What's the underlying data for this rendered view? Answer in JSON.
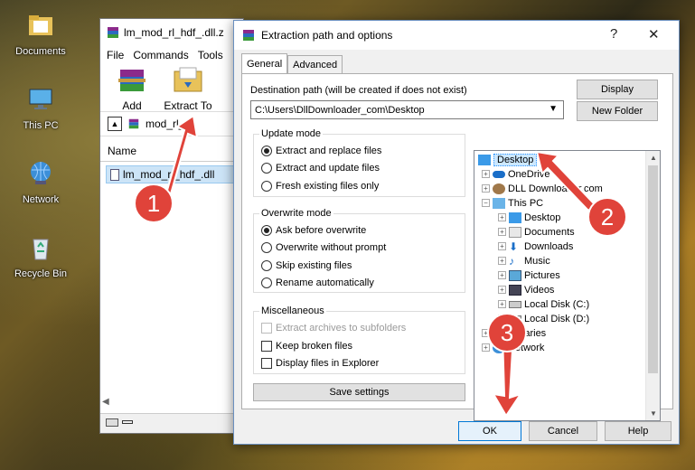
{
  "desktop": {
    "icons": [
      {
        "label": "Documents",
        "icon": "folder-icon"
      },
      {
        "label": "This PC",
        "icon": "computer-icon"
      },
      {
        "label": "Network",
        "icon": "network-icon"
      },
      {
        "label": "Recycle Bin",
        "icon": "recycle-bin-icon"
      }
    ]
  },
  "winrar": {
    "title": "lm_mod_rl_hdf_.dll.z",
    "menu": [
      "File",
      "Commands",
      "Tools"
    ],
    "tools": [
      {
        "label": "Add",
        "icon": "add-archive-icon"
      },
      {
        "label": "Extract To",
        "icon": "extract-to-icon"
      }
    ],
    "path": "mod_rl_",
    "column_name": "Name",
    "file": "lm_mod_rl_hdf_.dll"
  },
  "dialog": {
    "title": "Extraction path and options",
    "help": "?",
    "close": "✕",
    "tabs": [
      "General",
      "Advanced"
    ],
    "dest_label": "Destination path (will be created if does not exist)",
    "dest_value": "C:\\Users\\DllDownloader_com\\Desktop",
    "display_button": "Display",
    "new_folder_button": "New Folder",
    "update_mode": {
      "title": "Update mode",
      "options": [
        "Extract and replace files",
        "Extract and update files",
        "Fresh existing files only"
      ],
      "selected": 0
    },
    "overwrite_mode": {
      "title": "Overwrite mode",
      "options": [
        "Ask before overwrite",
        "Overwrite without prompt",
        "Skip existing files",
        "Rename automatically"
      ],
      "selected": 0
    },
    "misc": {
      "title": "Miscellaneous",
      "options": [
        "Extract archives to subfolders",
        "Keep broken files",
        "Display files in Explorer"
      ]
    },
    "save_settings": "Save settings",
    "tree": [
      {
        "label": "Desktop",
        "selected": true
      },
      {
        "label": "OneDrive"
      },
      {
        "label": "DLL Downloader.com"
      },
      {
        "label": "This PC"
      },
      {
        "label": "Desktop"
      },
      {
        "label": "Documents"
      },
      {
        "label": "Downloads"
      },
      {
        "label": "Music"
      },
      {
        "label": "Pictures"
      },
      {
        "label": "Videos"
      },
      {
        "label": "Local Disk (C:)"
      },
      {
        "label": "Local Disk (D:)"
      },
      {
        "label": "Libraries"
      },
      {
        "label": "Network"
      }
    ],
    "ok": "OK",
    "cancel": "Cancel",
    "help_button": "Help"
  },
  "annotations": [
    "1",
    "2",
    "3"
  ],
  "colors": {
    "annotation": "#e0433a",
    "selection": "#cce8ff",
    "ok_border": "#0078d7"
  }
}
